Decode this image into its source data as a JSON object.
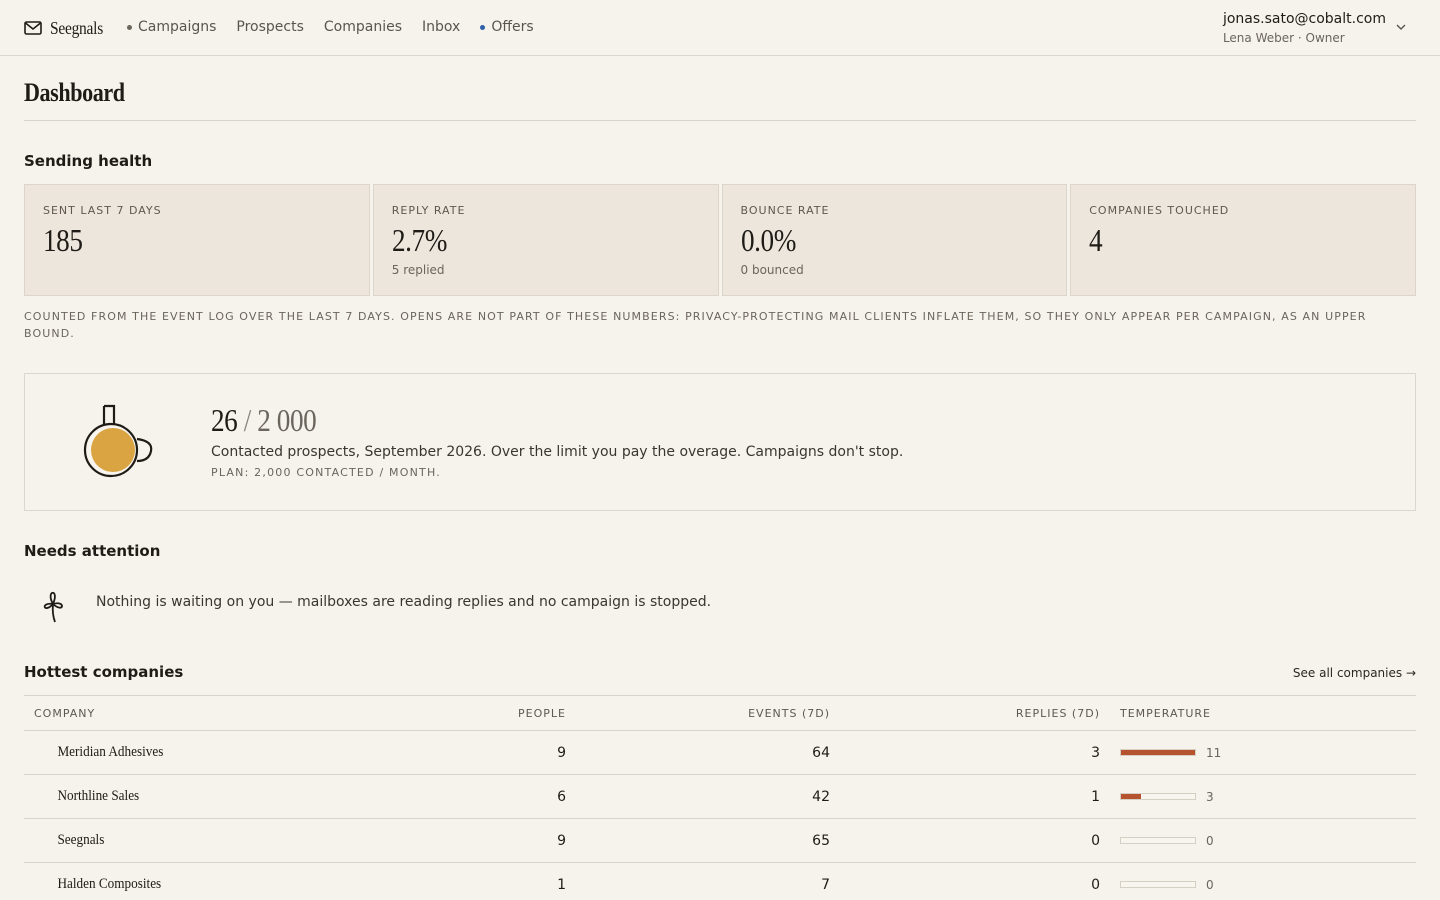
{
  "header": {
    "brand": "Seegnals",
    "nav": [
      {
        "label": "Campaigns",
        "dot": "#6b655c"
      },
      {
        "label": "Prospects"
      },
      {
        "label": "Companies"
      },
      {
        "label": "Inbox"
      },
      {
        "label": "Offers",
        "dot": "#2f5fa8"
      }
    ],
    "account": {
      "email": "jonas.sato@cobalt.com",
      "subtitle": "Lena Weber · Owner"
    }
  },
  "page": {
    "title": "Dashboard"
  },
  "sending_health": {
    "title": "Sending health",
    "stats": [
      {
        "label": "SENT LAST 7 DAYS",
        "value": "185",
        "sub": ""
      },
      {
        "label": "REPLY RATE",
        "value": "2.7%",
        "sub": "5 replied"
      },
      {
        "label": "BOUNCE RATE",
        "value": "0.0%",
        "sub": "0 bounced"
      },
      {
        "label": "COMPANIES TOUCHED",
        "value": "4",
        "sub": ""
      }
    ],
    "footnote": "COUNTED FROM THE EVENT LOG OVER THE LAST 7 DAYS. OPENS ARE NOT PART OF THESE NUMBERS: PRIVACY-PROTECTING MAIL CLIENTS INFLATE THEM, SO THEY ONLY APPEAR PER CAMPAIGN, AS AN UPPER BOUND."
  },
  "usage": {
    "used": "26",
    "separator": "/",
    "limit": "2 000",
    "fill_fraction": 0.013,
    "description": "Contacted prospects, September 2026. Over the limit you pay the overage. Campaigns don't stop.",
    "plan": "PLAN: 2,000 CONTACTED / MONTH."
  },
  "attention": {
    "title": "Needs attention",
    "message": "Nothing is waiting on you — mailboxes are reading replies and no campaign is stopped."
  },
  "companies": {
    "title": "Hottest companies",
    "see_all": "See all companies →",
    "columns": {
      "company": "COMPANY",
      "people": "PEOPLE",
      "events": "EVENTS (7D)",
      "replies": "REPLIES (7D)",
      "temperature": "TEMPERATURE"
    },
    "temperature_max": 11,
    "rows": [
      {
        "company": "Meridian Adhesives",
        "people": "9",
        "events": "64",
        "replies": "3",
        "temperature": 11
      },
      {
        "company": "Northline Sales",
        "people": "6",
        "events": "42",
        "replies": "1",
        "temperature": 3
      },
      {
        "company": "Seegnals",
        "people": "9",
        "events": "65",
        "replies": "0",
        "temperature": 0
      },
      {
        "company": "Halden Composites",
        "people": "1",
        "events": "7",
        "replies": "0",
        "temperature": 0
      }
    ]
  },
  "colors": {
    "accent": "#b5532f",
    "usage_fill": "#d9a441",
    "background": "#f6f3ed",
    "card": "#ede6dc"
  },
  "icons": {
    "brand": "mail-icon",
    "account": "chevron-down-icon",
    "usage": "jug-icon",
    "attention": "flower-icon"
  }
}
